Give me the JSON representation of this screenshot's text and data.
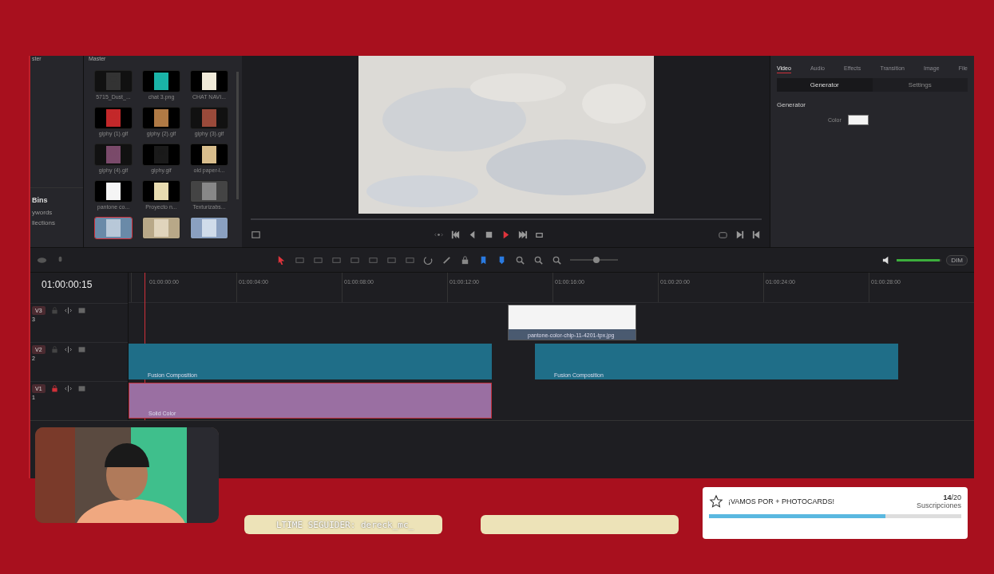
{
  "bins_panel": {
    "header": "ster",
    "heading": "Bins",
    "items": [
      "ywords",
      "llections"
    ]
  },
  "media_pool": {
    "header": "Master",
    "clips": [
      {
        "name": "5715_Dust_...",
        "selected": false
      },
      {
        "name": "chat 3.png",
        "selected": false
      },
      {
        "name": "CHAT NAVI...",
        "selected": false
      },
      {
        "name": "giphy (1).gif",
        "selected": false
      },
      {
        "name": "giphy (2).gif",
        "selected": false
      },
      {
        "name": "giphy (3).gif",
        "selected": false
      },
      {
        "name": "giphy (4).gif",
        "selected": false
      },
      {
        "name": "giphy.gif",
        "selected": false
      },
      {
        "name": "old paper-l...",
        "selected": false
      },
      {
        "name": "pantone co...",
        "selected": false
      },
      {
        "name": "Proyecto n...",
        "selected": false
      },
      {
        "name": "Texturizabs...",
        "selected": false
      },
      {
        "selected": true
      },
      {
        "selected": false
      },
      {
        "selected": false
      }
    ]
  },
  "inspector": {
    "tabs": [
      {
        "label": "Video",
        "selected": true
      },
      {
        "label": "Audio",
        "selected": false
      },
      {
        "label": "Effects",
        "selected": false
      },
      {
        "label": "Transition",
        "selected": false
      },
      {
        "label": "Image",
        "selected": false
      },
      {
        "label": "File",
        "selected": false
      }
    ],
    "subtabs": [
      {
        "label": "Generator",
        "selected": true
      },
      {
        "label": "Settings",
        "selected": false
      }
    ],
    "section": "Generator",
    "color_label": "Color"
  },
  "timeline": {
    "timecode": "01:00:00:15",
    "ruler": [
      "01:00:00:00",
      "01:00:04:00",
      "01:00:08:00",
      "01:00:12:00",
      "01:00:16:00",
      "01:00:20:00",
      "01:00:24:00",
      "01:00:28:00"
    ],
    "tracks": [
      {
        "label": "V3",
        "number": "3",
        "locked": false,
        "clips": [
          {
            "name": "pantone-color-chip-11-4201-tpx.jpg"
          }
        ]
      },
      {
        "label": "V2",
        "number": "2",
        "locked": false,
        "clips": [
          {
            "name": "Fusion Composition",
            "kind": "fusion"
          },
          {
            "name": "Fusion Composition",
            "kind": "fusion"
          }
        ]
      },
      {
        "label": "V1",
        "number": "1",
        "locked": true,
        "clips": [
          {
            "name": "Solid Color",
            "kind": "solid"
          }
        ]
      }
    ]
  },
  "zoom": {
    "level": 0.55
  },
  "audio": {
    "level": 0.95,
    "dim": "DIM"
  },
  "banners": [
    "LTIME SEGUIDER: dereck_mc_"
  ],
  "goal": {
    "title": "¡VAMOS POR + PHOTOCARDS!",
    "count": "**14**/20",
    "label": "Suscripciones",
    "level": 0.7
  }
}
